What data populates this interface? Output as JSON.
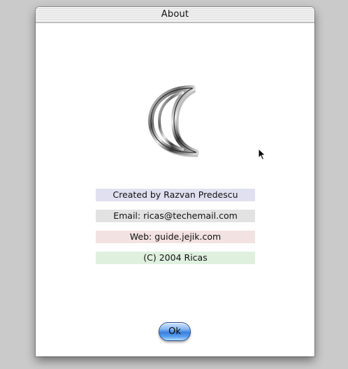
{
  "window": {
    "title": "About"
  },
  "logo": {
    "icon": "crescent-moon-icon"
  },
  "info": {
    "author": "Created by Razvan Predescu",
    "email": "Email: ricas@techemail.com",
    "web": "Web: guide.jejik.com",
    "copyright": "(C) 2004 Ricas"
  },
  "buttons": {
    "ok_label": "Ok"
  },
  "colors": {
    "author_row": "#e0e0f0",
    "email_row": "#e2e2e2",
    "web_row": "#f3e2e2",
    "copyright_row": "#dff0df",
    "ok_button_accent": "#3a7fdc"
  }
}
